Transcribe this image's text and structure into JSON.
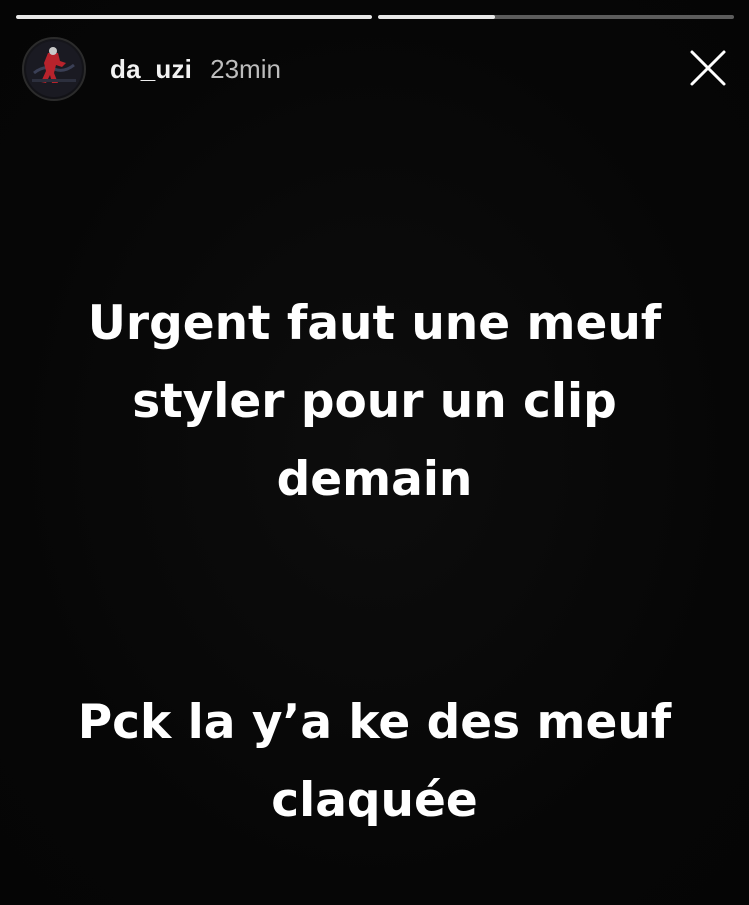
{
  "story": {
    "progress": [
      {
        "segment": 1,
        "fill_fraction": 1.0
      },
      {
        "segment": 2,
        "fill_fraction": 0.33
      }
    ],
    "user": {
      "username": "da_uzi",
      "time_ago": "23min",
      "avatar_icon": "profile-avatar"
    },
    "close_icon": "close-icon",
    "text_blocks": [
      {
        "lines": [
          "Urgent faut une meuf",
          "styler pour un clip",
          "demain"
        ]
      },
      {
        "lines": [
          "Pck la y’a ke des meuf",
          "claquée"
        ]
      }
    ]
  },
  "colors": {
    "background": "#070707",
    "text": "#ffffff",
    "timestamp": "#bdbdbd",
    "progress_track": "#5a5a5a",
    "progress_fill": "#e8e8e8"
  }
}
